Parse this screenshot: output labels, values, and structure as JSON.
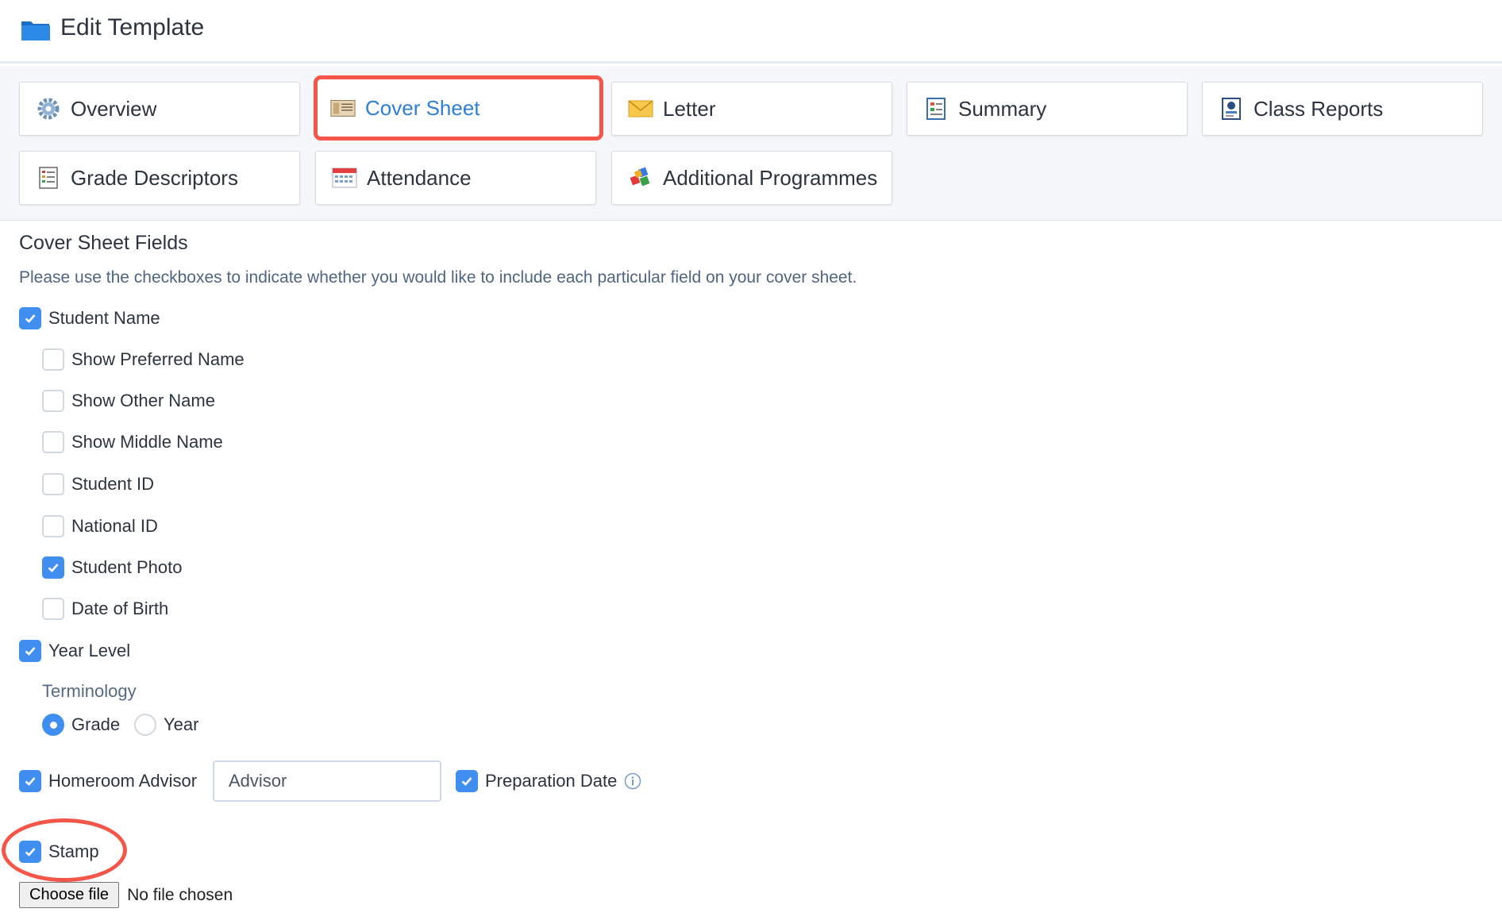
{
  "header": {
    "title": "Edit Template",
    "icon": "folder-icon"
  },
  "tabs": [
    {
      "label": "Overview",
      "icon": "gear-icon",
      "active": false
    },
    {
      "label": "Cover Sheet",
      "icon": "cover-sheet-icon",
      "active": true
    },
    {
      "label": "Letter",
      "icon": "envelope-icon",
      "active": false
    },
    {
      "label": "Summary",
      "icon": "summary-icon",
      "active": false
    },
    {
      "label": "Class Reports",
      "icon": "class-reports-icon",
      "active": false
    },
    {
      "label": "Grade Descriptors",
      "icon": "grade-descriptors-icon",
      "active": false
    },
    {
      "label": "Attendance",
      "icon": "calendar-icon",
      "active": false
    },
    {
      "label": "Additional Programmes",
      "icon": "puzzle-icon",
      "active": false
    }
  ],
  "section": {
    "title": "Cover Sheet Fields",
    "description": "Please use the checkboxes to indicate whether you would like to include each particular field on your cover sheet."
  },
  "fields": {
    "student_name": {
      "label": "Student Name",
      "checked": true
    },
    "preferred_name": {
      "label": "Show Preferred Name",
      "checked": false
    },
    "other_name": {
      "label": "Show Other Name",
      "checked": false
    },
    "middle_name": {
      "label": "Show Middle Name",
      "checked": false
    },
    "student_id": {
      "label": "Student ID",
      "checked": false
    },
    "national_id": {
      "label": "National ID",
      "checked": false
    },
    "student_photo": {
      "label": "Student Photo",
      "checked": true
    },
    "date_of_birth": {
      "label": "Date of Birth",
      "checked": false
    },
    "year_level": {
      "label": "Year Level",
      "checked": true
    },
    "homeroom_advisor": {
      "label": "Homeroom Advisor",
      "checked": true,
      "input_value": "Advisor"
    },
    "preparation_date": {
      "label": "Preparation Date",
      "checked": true
    },
    "stamp": {
      "label": "Stamp",
      "checked": true
    }
  },
  "terminology": {
    "label": "Terminology",
    "options": [
      {
        "label": "Grade",
        "selected": true
      },
      {
        "label": "Year",
        "selected": false
      }
    ]
  },
  "file_upload": {
    "button_label": "Choose file",
    "status": "No file chosen"
  },
  "colors": {
    "accent": "#3f8ef0",
    "highlight": "#f4564a",
    "active_tab_text": "#2f7fd6"
  }
}
